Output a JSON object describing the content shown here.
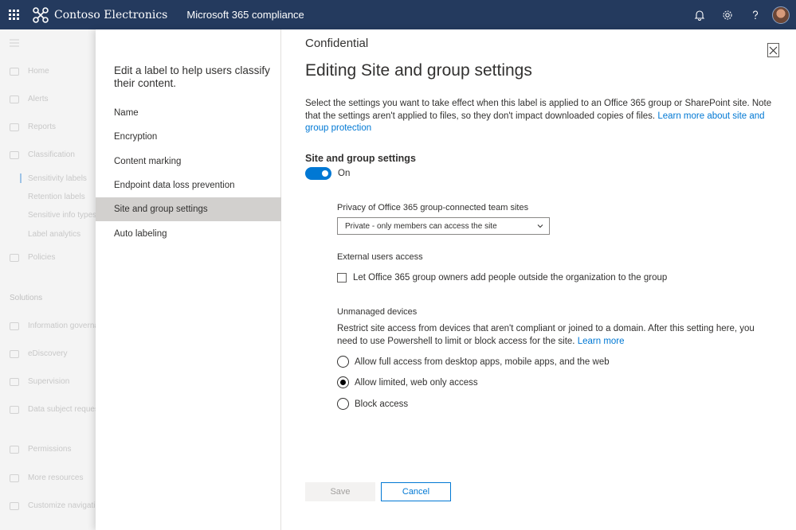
{
  "header": {
    "brand": "Contoso Electronics",
    "app": "Microsoft 365 compliance",
    "icons": [
      "waffle-icon",
      "bell-icon",
      "gear-icon",
      "help-icon"
    ]
  },
  "leftnav": {
    "items": [
      {
        "label": "Home"
      },
      {
        "label": "Alerts"
      },
      {
        "label": "Reports"
      },
      {
        "label": "Classification"
      },
      {
        "label": "Sensitivity labels"
      },
      {
        "label": "Retention labels"
      },
      {
        "label": "Sensitive info types"
      },
      {
        "label": "Label analytics"
      },
      {
        "label": "Policies"
      },
      {
        "label": "Solutions"
      },
      {
        "label": "Information governance"
      },
      {
        "label": "eDiscovery"
      },
      {
        "label": "Supervision"
      },
      {
        "label": "Data subject requests"
      },
      {
        "label": "Permissions"
      },
      {
        "label": "More resources"
      },
      {
        "label": "Customize navigation"
      }
    ]
  },
  "wizard": {
    "intro": "Edit a label to help users classify their content.",
    "steps": [
      {
        "label": "Name"
      },
      {
        "label": "Encryption"
      },
      {
        "label": "Content marking"
      },
      {
        "label": "Endpoint data loss prevention"
      },
      {
        "label": "Site and group settings"
      },
      {
        "label": "Auto labeling"
      }
    ],
    "active_step": 4
  },
  "content": {
    "label_name": "Confidential",
    "title": "Editing Site and group settings",
    "description": "Select the settings you want to take effect when this label is applied to an Office 365 group or SharePoint site. Note that the settings aren't applied to files, so they don't impact downloaded copies of files.",
    "learn_more_link": "Learn more about site and group protection",
    "section_title": "Site and group settings",
    "toggle_state": "On",
    "privacy_label": "Privacy of Office 365 group-connected team sites",
    "privacy_value": "Private - only members can access the site",
    "external_label": "External users access",
    "external_checkbox": "Let Office 365 group owners add people outside the organization to the group",
    "unmanaged_label": "Unmanaged devices",
    "unmanaged_desc": "Restrict site access from devices that aren't compliant or joined to a domain. After this setting here, you need to use Powershell to limit or block access for the site.",
    "unmanaged_link": "Learn more",
    "radio_options": [
      {
        "label": "Allow full access from desktop apps, mobile apps, and the web"
      },
      {
        "label": "Allow limited, web only access"
      },
      {
        "label": "Block access"
      }
    ],
    "selected_radio": 1,
    "save_label": "Save",
    "cancel_label": "Cancel"
  },
  "colors": {
    "header_bg": "#243a5e",
    "accent": "#0078d4",
    "active_step_bg": "#d2d0ce"
  }
}
